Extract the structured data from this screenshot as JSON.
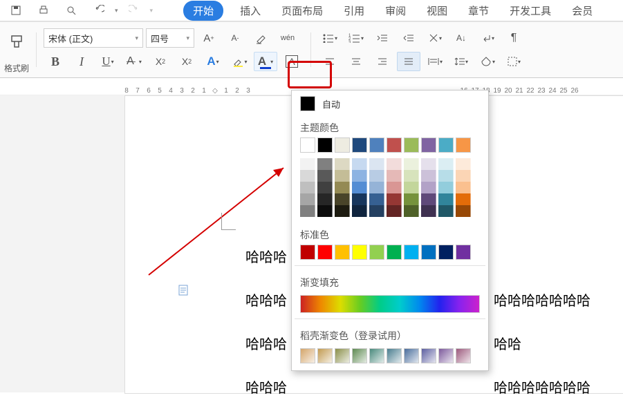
{
  "qat": {
    "tooltip": ""
  },
  "tabs": {
    "items": [
      {
        "label": "开始",
        "active": true
      },
      {
        "label": "插入"
      },
      {
        "label": "页面布局"
      },
      {
        "label": "引用"
      },
      {
        "label": "审阅"
      },
      {
        "label": "视图"
      },
      {
        "label": "章节"
      },
      {
        "label": "开发工具"
      },
      {
        "label": "会员"
      }
    ]
  },
  "ribbon": {
    "format_painter": "格式刷",
    "font_name": "宋体 (正文)",
    "font_size": "四号"
  },
  "ruler": {
    "left": [
      "8",
      "7",
      "6",
      "5",
      "4",
      "3",
      "2",
      "1"
    ],
    "right_start": [
      "1",
      "2",
      "3"
    ],
    "right_end": [
      "16",
      "17",
      "18",
      "19",
      "20",
      "21",
      "22",
      "23",
      "24",
      "25",
      "26"
    ]
  },
  "document": {
    "lines": [
      "哈哈哈",
      "哈哈哈",
      "哈哈哈",
      "哈哈哈"
    ],
    "trail1": "哈哈哈哈哈哈哈",
    "trail2": "哈哈",
    "trail3": "哈哈哈哈哈哈哈"
  },
  "dropdown": {
    "auto": "自动",
    "theme": "主题颜色",
    "standard": "标准色",
    "gradient": "渐变填充",
    "docer": "稻壳渐变色（登录试用）",
    "theme_base": [
      "#ffffff",
      "#000000",
      "#eeece1",
      "#1f497d",
      "#4f81bd",
      "#c0504d",
      "#9bbb59",
      "#8064a2",
      "#4bacc6",
      "#f79646"
    ],
    "theme_shades": [
      [
        "#f2f2f2",
        "#d9d9d9",
        "#bfbfbf",
        "#a6a6a6",
        "#808080"
      ],
      [
        "#808080",
        "#595959",
        "#404040",
        "#262626",
        "#0d0d0d"
      ],
      [
        "#ddd9c3",
        "#c4bd97",
        "#948a54",
        "#494429",
        "#1d1b10"
      ],
      [
        "#c6d9f0",
        "#8db3e2",
        "#548dd4",
        "#17365d",
        "#0f243e"
      ],
      [
        "#dbe5f1",
        "#b8cce4",
        "#95b3d7",
        "#366092",
        "#244061"
      ],
      [
        "#f2dcdb",
        "#e5b9b7",
        "#d99694",
        "#953734",
        "#632423"
      ],
      [
        "#ebf1dd",
        "#d7e3bc",
        "#c3d69b",
        "#76923c",
        "#4f6128"
      ],
      [
        "#e5e0ec",
        "#ccc1d9",
        "#b2a2c7",
        "#5f497a",
        "#3f3151"
      ],
      [
        "#dbeef3",
        "#b7dde8",
        "#92cddc",
        "#31859b",
        "#205867"
      ],
      [
        "#fdeada",
        "#fbd5b5",
        "#fac08f",
        "#e36c09",
        "#974806"
      ]
    ],
    "standard_colors": [
      "#c00000",
      "#ff0000",
      "#ffc000",
      "#ffff00",
      "#92d050",
      "#00b050",
      "#00b0f0",
      "#0070c0",
      "#002060",
      "#7030a0"
    ],
    "docer_colors": [
      "#d4a56a",
      "#c29b52",
      "#8a8f4a",
      "#5e8a52",
      "#4a8a7d",
      "#4a7d8f",
      "#4a6d9c",
      "#5d5fa0",
      "#7d5a9c",
      "#9c5a7d"
    ]
  }
}
